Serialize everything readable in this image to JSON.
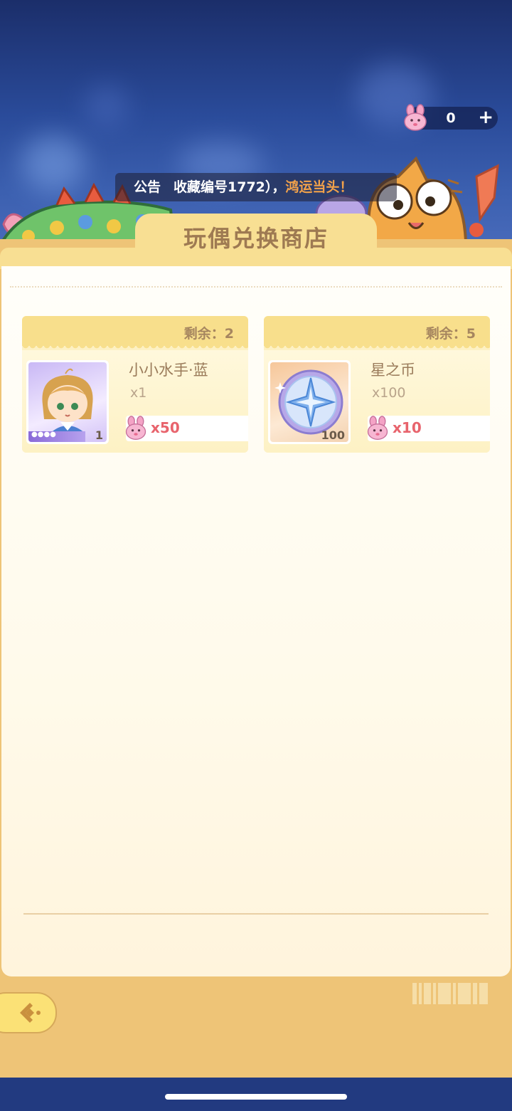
{
  "currency": {
    "count": "0",
    "plus": "+",
    "icon": "pink-bunny-icon"
  },
  "notice": {
    "label": "公告",
    "text": "收藏编号1772），",
    "highlight": "鸿运当头！"
  },
  "shop": {
    "title": "玩偶兑换商店"
  },
  "items": [
    {
      "remaining": "剩余：2",
      "name": "小小水手·蓝",
      "amount": "x1",
      "qty": "1",
      "price": "x50",
      "icon": "doll-portrait"
    },
    {
      "remaining": "剩余：5",
      "name": "星之币",
      "amount": "x100",
      "qty": "100",
      "price": "x10",
      "icon": "star-coin-icon"
    }
  ],
  "colors": {
    "accent": "#e8646d",
    "panel": "#eec477",
    "header": "#f8df8c"
  }
}
